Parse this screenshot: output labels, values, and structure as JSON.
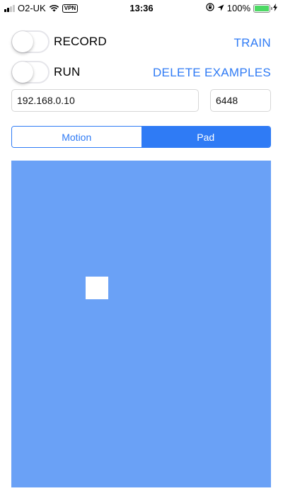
{
  "status_bar": {
    "carrier": "O2-UK",
    "vpn": "VPN",
    "time": "13:36",
    "battery": "100%",
    "battery_level": 1.0,
    "icons": [
      "signal-icon",
      "wifi-icon",
      "orientation-lock-icon",
      "location-icon",
      "battery-icon",
      "charging-icon"
    ]
  },
  "controls": {
    "record_label": "RECORD",
    "record_on": false,
    "run_label": "RUN",
    "run_on": false,
    "train_label": "TRAIN",
    "delete_label": "DELETE EXAMPLES"
  },
  "connection": {
    "host": "192.168.0.10",
    "port": "6448"
  },
  "mode_tabs": {
    "items": [
      "Motion",
      "Pad"
    ],
    "selected": "Pad"
  },
  "pad": {
    "cursor_x": 0.33,
    "cursor_y": 0.39
  },
  "colors": {
    "accent": "#2f7bf5",
    "pad_background": "#6aa1f6",
    "battery": "#4cd964"
  }
}
